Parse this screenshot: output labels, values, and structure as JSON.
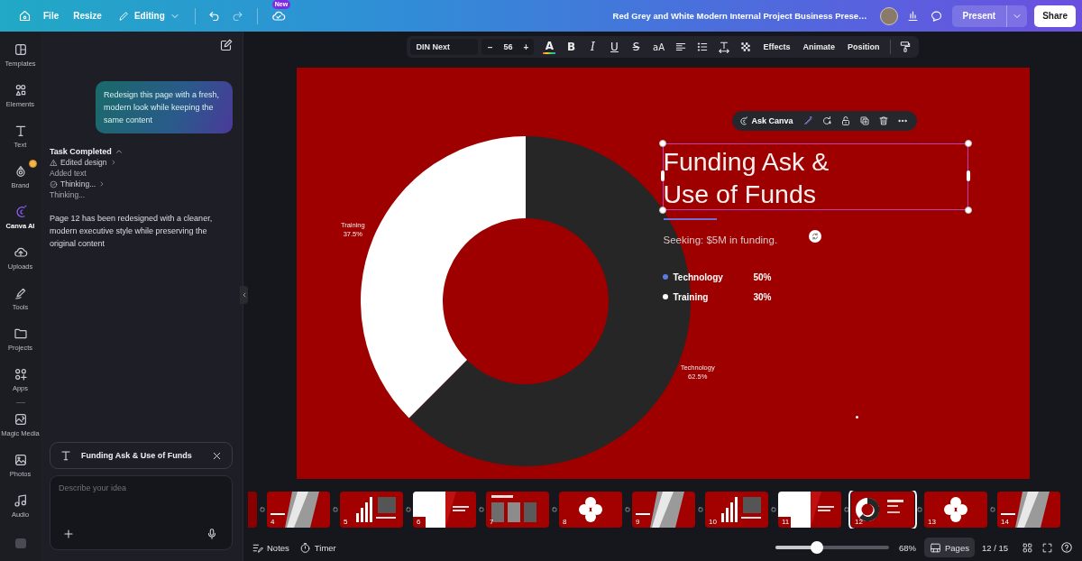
{
  "top_bar": {
    "menu": [
      "File",
      "Resize"
    ],
    "mode": "Editing",
    "badge": "New",
    "title": "Red Grey and White Modern Internal Project Business Prese…",
    "present": "Present",
    "share": "Share"
  },
  "rail": [
    {
      "label": "Templates",
      "selected": false,
      "badge": false
    },
    {
      "label": "Elements",
      "selected": false,
      "badge": false
    },
    {
      "label": "Text",
      "selected": false,
      "badge": false
    },
    {
      "label": "Brand",
      "selected": false,
      "badge": true
    },
    {
      "label": "Canva AI",
      "selected": true,
      "badge": false
    },
    {
      "label": "Uploads",
      "selected": false,
      "badge": false
    },
    {
      "label": "Tools",
      "selected": false,
      "badge": false
    },
    {
      "label": "Projects",
      "selected": false,
      "badge": false
    },
    {
      "label": "Apps",
      "selected": false,
      "badge": false
    },
    {
      "label": "Magic Media",
      "selected": false,
      "badge": false
    },
    {
      "label": "Photos",
      "selected": false,
      "badge": false
    },
    {
      "label": "Audio",
      "selected": false,
      "badge": false
    }
  ],
  "assistant": {
    "prompt": "Redesign this page with a fresh, modern look while keeping the same content",
    "status": "Task Completed",
    "steps": [
      {
        "kind": "action",
        "label": "Edited design",
        "detail": "Added text"
      },
      {
        "kind": "thinking",
        "label": "Thinking...",
        "detail": "Thinking..."
      }
    ],
    "reply": "Page 12 has been redesigned with a cleaner, modern executive style while preserving the original content",
    "context_chip": "Funding Ask & Use of Funds",
    "input": {
      "placeholder": "Describe your idea"
    }
  },
  "text_toolbar": {
    "font": "DIN Next",
    "size": "56",
    "minus": "–",
    "plus": "+",
    "glyphs": [
      "A",
      "B",
      "I",
      "U",
      "S",
      "aA"
    ],
    "actions": [
      "Effects",
      "Animate",
      "Position"
    ]
  },
  "slide": {
    "element_toolbar": {
      "label": "Ask Canva"
    },
    "title": "Funding Ask &\nUse of Funds",
    "subtitle": "Seeking: $5M in funding.",
    "legend": [
      {
        "label": "Technology",
        "value": "50%",
        "color": "#5b7be0"
      },
      {
        "label": "Training",
        "value": "30%",
        "color": "#ffffff"
      }
    ],
    "chart_data": {
      "type": "donut",
      "categories": [
        "Technology",
        "Training"
      ],
      "values": [
        62.5,
        37.5
      ],
      "value_labels": [
        "62.5%",
        "37.5%"
      ]
    }
  },
  "pages": [
    {
      "number": "4",
      "selected": false
    },
    {
      "number": "5",
      "selected": false
    },
    {
      "number": "6",
      "selected": false
    },
    {
      "number": "7",
      "selected": false
    },
    {
      "number": "8",
      "selected": false
    },
    {
      "number": "9",
      "selected": false
    },
    {
      "number": "10",
      "selected": false
    },
    {
      "number": "11",
      "selected": false
    },
    {
      "number": "12",
      "selected": true
    },
    {
      "number": "13",
      "selected": false
    },
    {
      "number": "14",
      "selected": false
    }
  ],
  "bottom_bar": {
    "notes": "Notes",
    "timer": "Timer",
    "zoom": {
      "level": 0.38
    },
    "zoom_reading": "68%",
    "pages_button": {
      "label": "Pages",
      "selected": true
    },
    "page_count": "12 / 15"
  }
}
